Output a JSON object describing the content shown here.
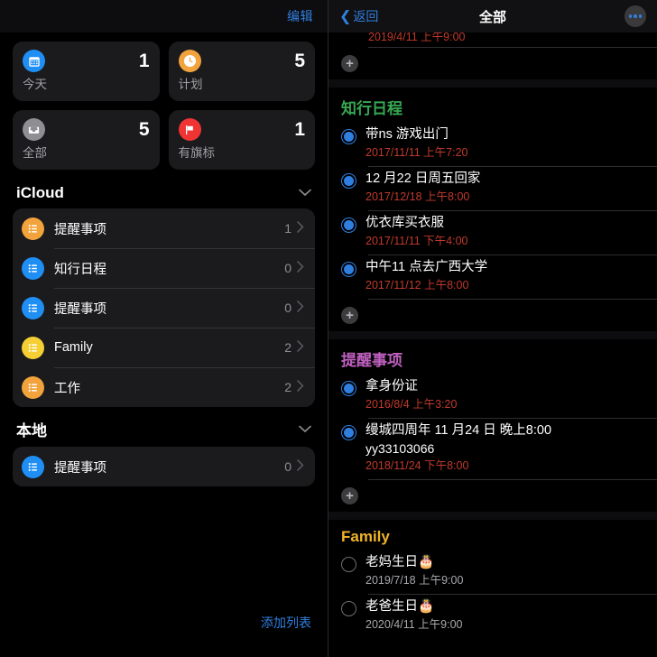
{
  "colors": {
    "accent_blue": "#2f7fe0",
    "green": "#36a852",
    "pink": "#c060c0",
    "yellow": "#f0b429",
    "red_date": "#c0392b",
    "orange": "#f2a33c",
    "list_blue": "#1f8ff5",
    "list_yellow": "#f5cf33",
    "card_today_blue": "#1f8ff5",
    "card_sched_orange": "#f2a33c",
    "card_all_grey": "#8e8e93",
    "card_flag_red": "#f03434"
  },
  "left": {
    "nav": {
      "edit_label": "编辑"
    },
    "cards": [
      {
        "icon": "calendar-icon",
        "label": "今天",
        "count": "1",
        "color": "#1f8ff5"
      },
      {
        "icon": "clock-icon",
        "label": "计划",
        "count": "5",
        "color": "#f2a33c"
      },
      {
        "icon": "inbox-icon",
        "label": "全部",
        "count": "5",
        "color": "#8e8e93"
      },
      {
        "icon": "flag-icon",
        "label": "有旗标",
        "count": "1",
        "color": "#f03434"
      }
    ],
    "sections": [
      {
        "title": "iCloud",
        "rows": [
          {
            "icon": "list-icon",
            "label": "提醒事项",
            "count": "1",
            "color": "#f2a33c"
          },
          {
            "icon": "list-icon",
            "label": "知行日程",
            "count": "0",
            "color": "#1f8ff5"
          },
          {
            "icon": "list-icon",
            "label": "提醒事项",
            "count": "0",
            "color": "#1f8ff5"
          },
          {
            "icon": "list-icon",
            "label": "Family",
            "count": "2",
            "color": "#f5cf33"
          },
          {
            "icon": "list-icon",
            "label": "工作",
            "count": "2",
            "color": "#f2a33c"
          }
        ]
      },
      {
        "title": "本地",
        "rows": [
          {
            "icon": "list-icon",
            "label": "提醒事项",
            "count": "0",
            "color": "#1f8ff5"
          }
        ]
      }
    ],
    "add_list_label": "添加列表"
  },
  "right": {
    "nav": {
      "back_label": "返回",
      "title": "全部",
      "more_label": "更多"
    },
    "clipped_date": "2019/4/11 上午9:00",
    "groups": [
      {
        "title": "知行日程",
        "color": "#36a852",
        "tasks": [
          {
            "title": "带ns 游戏出门",
            "sub": "",
            "date": "2017/11/11 上午7:20",
            "date_color": "red",
            "state": "filled"
          },
          {
            "title": "12 月22 日周五回家",
            "sub": "",
            "date": "2017/12/18 上午8:00",
            "date_color": "red",
            "state": "filled"
          },
          {
            "title": "优衣库买衣服",
            "sub": "",
            "date": "2017/11/11 下午4:00",
            "date_color": "red",
            "state": "filled"
          },
          {
            "title": "中午11 点去广西大学",
            "sub": "",
            "date": "2017/11/12 上午8:00",
            "date_color": "red",
            "state": "filled"
          }
        ]
      },
      {
        "title": "提醒事项",
        "color": "#c060c0",
        "tasks": [
          {
            "title": "拿身份证",
            "sub": "",
            "date": "2016/8/4 上午3:20",
            "date_color": "red",
            "state": "filled"
          },
          {
            "title": "缦城四周年 11 月24 日 晚上8:00",
            "sub": "yy33103066",
            "date": "2018/11/24 下午8:00",
            "date_color": "red",
            "state": "filled"
          }
        ]
      },
      {
        "title": "Family",
        "color": "#f0b429",
        "tasks": [
          {
            "title": "老妈生日🎂",
            "sub": "",
            "date": "2019/7/18 上午9:00",
            "date_color": "grey",
            "state": "empty"
          },
          {
            "title": "老爸生日🎂",
            "sub": "",
            "date": "2020/4/11 上午9:00",
            "date_color": "grey",
            "state": "empty"
          }
        ]
      }
    ]
  }
}
